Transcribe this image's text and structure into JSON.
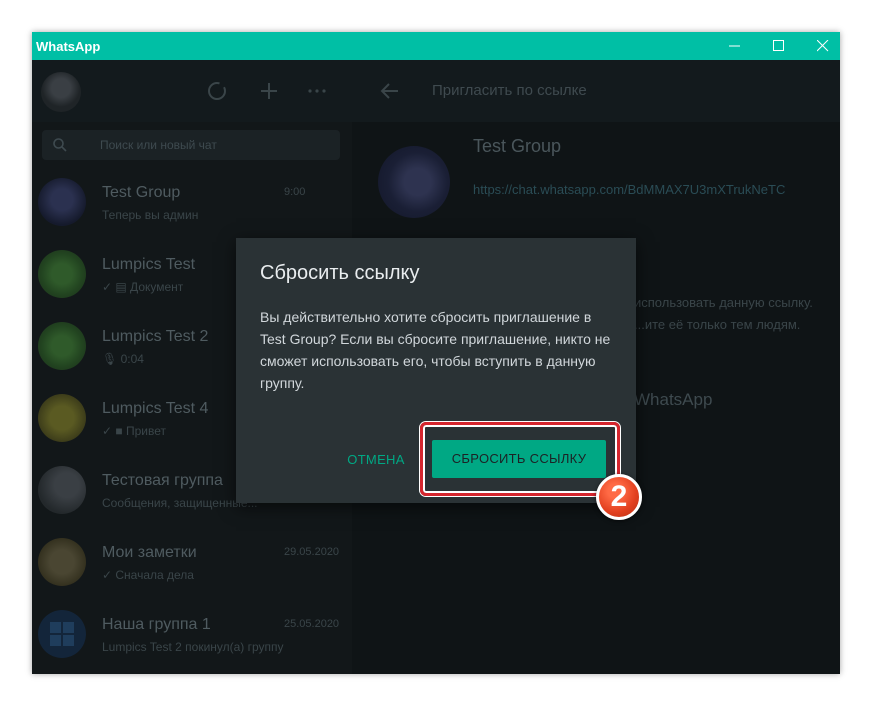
{
  "window": {
    "title": "WhatsApp"
  },
  "search": {
    "placeholder": "Поиск или новый чат"
  },
  "chats": [
    {
      "name": "Test Group",
      "snippet": "Теперь вы админ",
      "time": "9:00"
    },
    {
      "name": "Lumpics Test",
      "snippet": "✓ ▤ Документ",
      "time": ""
    },
    {
      "name": "Lumpics Test 2",
      "snippet": "🎙 0:04",
      "time": ""
    },
    {
      "name": "Lumpics Test 4",
      "snippet": "✓ ■ Привет",
      "time": ""
    },
    {
      "name": "Тестовая группа",
      "snippet": "Сообщения, защищенные...",
      "time": ""
    },
    {
      "name": "Мои заметки",
      "snippet": "✓ Сначала дела",
      "time": "29.05.2020"
    },
    {
      "name": "Наша группа 1",
      "snippet": "Lumpics Test 2 покинул(а) группу",
      "time": "25.05.2020"
    }
  ],
  "right": {
    "title": "Пригласить по ссылке",
    "group_name": "Test Group",
    "invite_link": "https://chat.whatsapp.com/BdMMAX7U3mXTrukNeTC",
    "desc": "использовать данную ссылку. ...ите её только тем людям.",
    "wa_label": "WhatsApp"
  },
  "dialog": {
    "title": "Сбросить ссылку",
    "body": "Вы действительно хотите сбросить приглашение в Test Group? Если вы сбросите приглашение, никто не сможет использовать его, чтобы вступить в данную группу.",
    "cancel_label": "ОТМЕНА",
    "reset_label": "СБРОСИТЬ ССЫЛКУ"
  },
  "annotation": {
    "step": "2"
  },
  "colors": {
    "titlebar": "#00bfa5",
    "accent": "#00a884",
    "dialog_bg": "#2a3235",
    "highlight": "#d6262e"
  }
}
